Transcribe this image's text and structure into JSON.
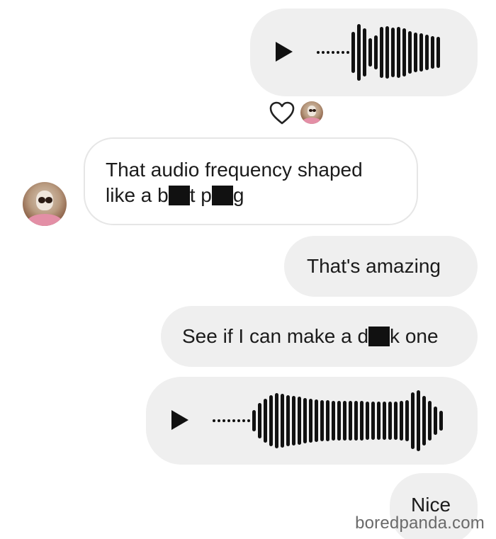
{
  "messages": [
    {
      "type": "voice",
      "direction": "outgoing"
    },
    {
      "type": "text",
      "direction": "incoming",
      "line1": "That audio frequency shaped",
      "line2_parts": [
        "like a b",
        "t p",
        "g"
      ]
    },
    {
      "type": "text",
      "direction": "outgoing",
      "text": "That's amazing"
    },
    {
      "type": "text",
      "direction": "outgoing",
      "parts": [
        "See if I can make a d",
        "k one"
      ]
    },
    {
      "type": "voice",
      "direction": "outgoing"
    },
    {
      "type": "text",
      "direction": "outgoing",
      "text": "Nice"
    }
  ],
  "reaction": {
    "icon": "heart-outline-icon"
  },
  "watermark": "boredpanda.com",
  "colors": {
    "outgoing_bubble": "#efefef",
    "incoming_border": "#e6e6e6",
    "text": "#1b1b1b",
    "redaction": "#111111"
  }
}
